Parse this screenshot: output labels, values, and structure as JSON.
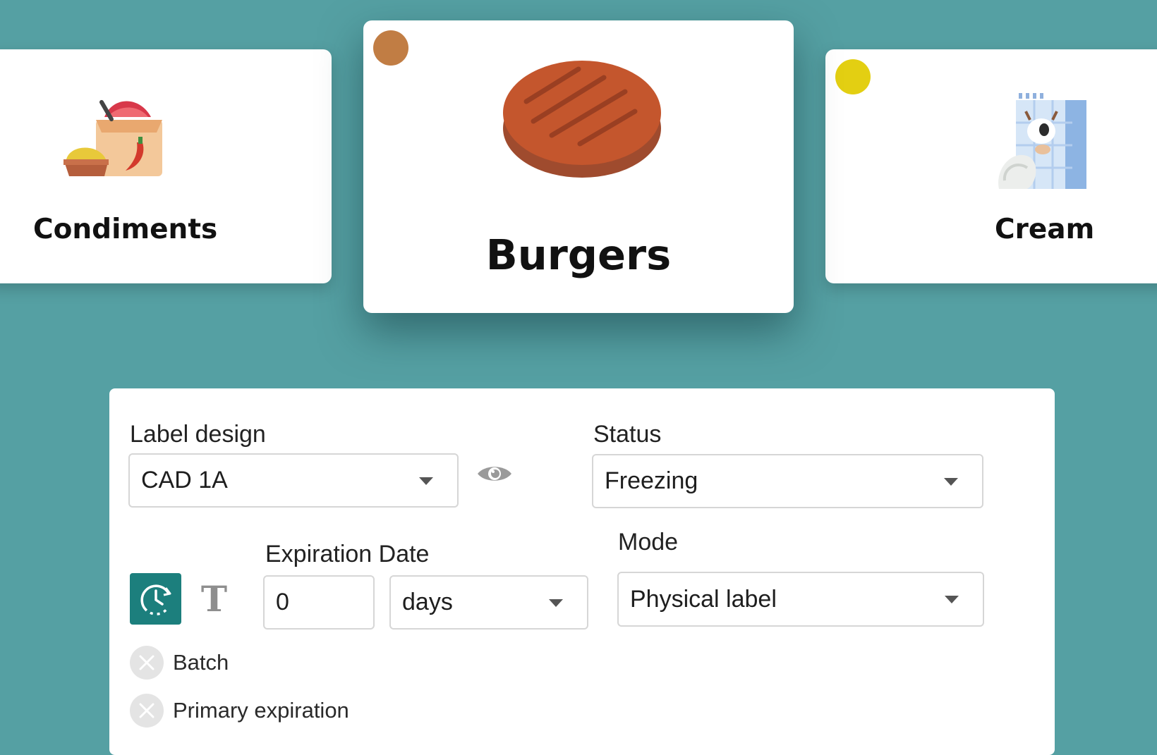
{
  "carousel": {
    "cards": [
      {
        "title": "Condiments",
        "icon": "condiments-sack-icon"
      },
      {
        "title": "Burgers",
        "icon": "burger-patty-icon",
        "dot_color": "#c17d44"
      },
      {
        "title": "Cream",
        "icon": "cream-carton-icon",
        "dot_color": "#e3cf12"
      }
    ]
  },
  "form": {
    "label_design": {
      "label": "Label design",
      "value": "CAD 1A"
    },
    "status": {
      "label": "Status",
      "value": "Freezing"
    },
    "expiration": {
      "label": "Expiration Date",
      "amount": "0",
      "unit": "days"
    },
    "mode": {
      "label": "Mode",
      "value": "Physical label"
    },
    "toggles": {
      "timer_icon": "clock-timer-icon",
      "text_glyph": "T"
    },
    "options": [
      {
        "label": "Batch",
        "checked": false
      },
      {
        "label": "Primary expiration",
        "checked": false
      }
    ]
  },
  "colors": {
    "background": "#55a0a3",
    "accent": "#1c7f7d"
  }
}
